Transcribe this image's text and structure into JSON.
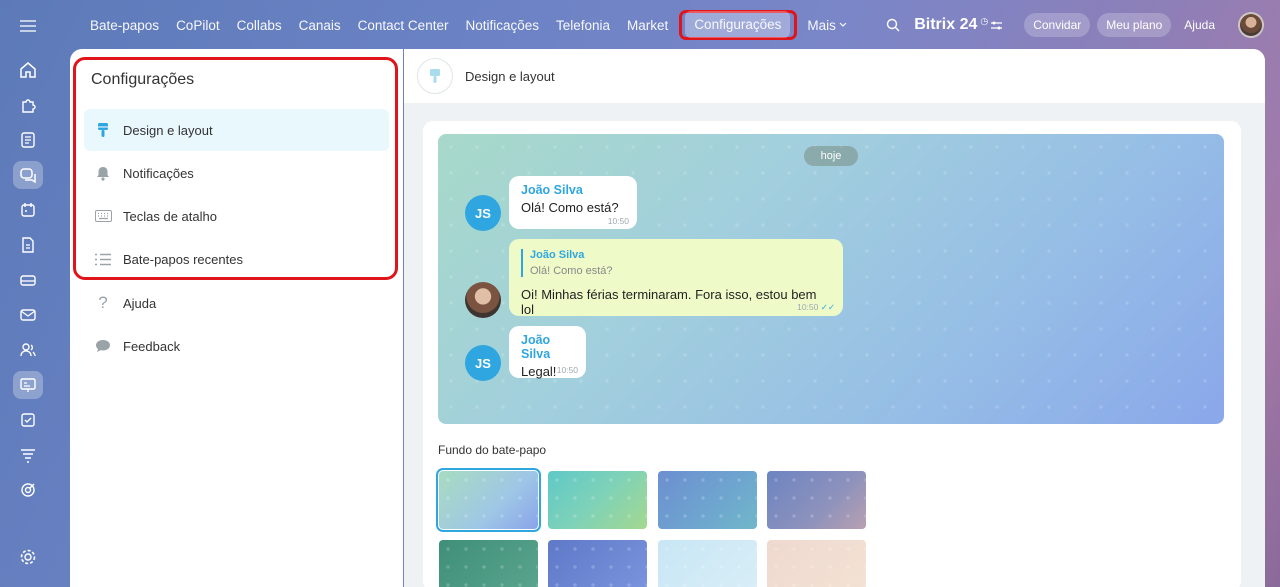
{
  "topnav": {
    "items": [
      "Bate-papos",
      "CoPilot",
      "Collabs",
      "Canais",
      "Contact Center",
      "Notificações",
      "Telefonia",
      "Market"
    ],
    "active": "Configurações",
    "more": "Mais"
  },
  "brand": {
    "name": "Bitrix 24"
  },
  "topright": {
    "invite": "Convidar",
    "plan": "Meu plano",
    "help": "Ajuda"
  },
  "sidebar": {
    "title": "Configurações",
    "items": [
      {
        "label": "Design e layout",
        "icon": "brush-icon"
      },
      {
        "label": "Notificações",
        "icon": "bell-icon"
      },
      {
        "label": "Teclas de atalho",
        "icon": "keyboard-icon"
      },
      {
        "label": "Bate-papos recentes",
        "icon": "list-icon"
      },
      {
        "label": "Ajuda",
        "icon": "question-icon"
      },
      {
        "label": "Feedback",
        "icon": "chat-bubble-icon"
      }
    ]
  },
  "main": {
    "title": "Design e layout",
    "preview": {
      "date": "hoje",
      "messages": [
        {
          "avatar": "JS",
          "name": "João Silva",
          "text": "Olá! Como está?",
          "time": "10:50"
        },
        {
          "quote_name": "João Silva",
          "quote_text": "Olá! Como está?",
          "text": "Oi! Minhas férias terminaram. Fora isso, estou bem lol",
          "time": "10:50"
        },
        {
          "avatar": "JS",
          "name": "João Silva",
          "text": "Legal!",
          "time": "10:50"
        }
      ]
    },
    "background_title": "Fundo do bate-papo"
  },
  "colors": {
    "accent": "#2fa6e0",
    "highlight": "#e0141b"
  }
}
